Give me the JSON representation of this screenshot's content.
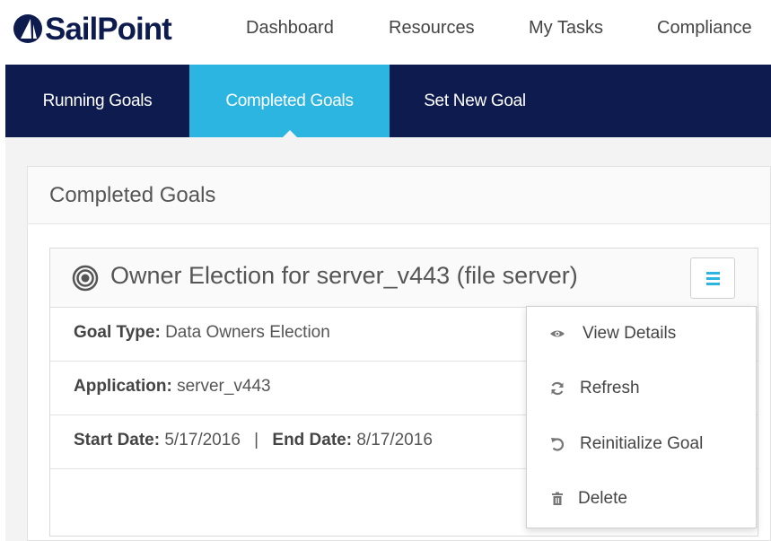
{
  "brand": {
    "name": "SailPoint",
    "color": "#0d1b4f"
  },
  "topnav": [
    "Dashboard",
    "Resources",
    "My Tasks",
    "Compliance"
  ],
  "subnav": {
    "tabs": [
      "Running Goals",
      "Completed Goals",
      "Set New Goal"
    ],
    "active": "Completed Goals",
    "accent": "#2bb5e0"
  },
  "panel": {
    "title": "Completed Goals"
  },
  "goal": {
    "icon": "target-icon",
    "title": "Owner Election for server_v443 (file server)",
    "menu_icon": "hamburger-menu-icon",
    "type_label": "Goal Type:",
    "type_value": "Data Owners Election",
    "application_label": "Application:",
    "application_value": "server_v443",
    "start_label": "Start Date:",
    "start_value": "5/17/2016",
    "separator": "|",
    "end_label": "End Date:",
    "end_value": "8/17/2016"
  },
  "menu": {
    "items": [
      {
        "label": "View Details",
        "icon": "eye-icon"
      },
      {
        "label": "Refresh",
        "icon": "refresh-icon"
      },
      {
        "label": "Reinitialize Goal",
        "icon": "undo-icon"
      },
      {
        "label": "Delete",
        "icon": "trash-icon"
      }
    ]
  }
}
